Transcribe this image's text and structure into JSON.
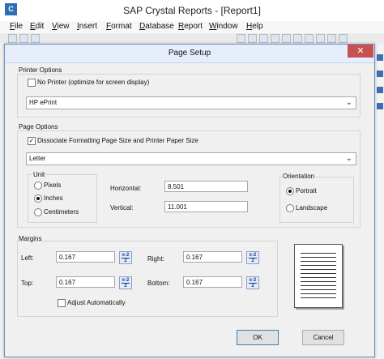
{
  "app": {
    "logo": "C",
    "title": "SAP Crystal Reports - [Report1]"
  },
  "menu": [
    "File",
    "Edit",
    "View",
    "Insert",
    "Format",
    "Database",
    "Report",
    "Window",
    "Help"
  ],
  "dialog": {
    "title": "Page Setup",
    "close_glyph": "✕",
    "printer_options": {
      "group_label": "Printer Options",
      "no_printer_label": "No Printer (optimize for screen display)",
      "no_printer_checked": false,
      "printer": "HP ePrint"
    },
    "page_options": {
      "group_label": "Page Options",
      "dissociate_label": "Dissociate Formatting Page Size and Printer Paper Size",
      "dissociate_checked": true,
      "paper_size": "Letter",
      "unit": {
        "label": "Unit",
        "options": [
          "Pixels",
          "Inches",
          "Centimeters"
        ],
        "selected": "Inches"
      },
      "horizontal_label": "Horizontal:",
      "horizontal_value": "8.501",
      "vertical_label": "Vertical:",
      "vertical_value": "11.001",
      "orientation": {
        "label": "Orientation",
        "options": [
          "Portrait",
          "Landscape"
        ],
        "selected": "Portrait"
      }
    },
    "margins": {
      "group_label": "Margins",
      "left_label": "Left:",
      "left_value": "0.167",
      "right_label": "Right:",
      "right_value": "0.167",
      "top_label": "Top:",
      "top_value": "0.167",
      "bottom_label": "Bottom:",
      "bottom_value": "0.167",
      "adjust_label": "Adjust Automatically",
      "adjust_checked": false,
      "calc_top": "x-2",
      "calc_bottom": "2"
    },
    "ok_label": "OK",
    "cancel_label": "Cancel"
  },
  "colors": {
    "close_button": "#c75050",
    "dialog_border": "#6d8fbf",
    "title_bar": "#e6eefb"
  }
}
